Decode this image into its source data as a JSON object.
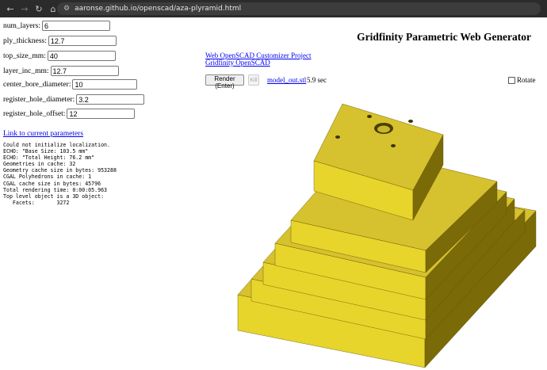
{
  "browser": {
    "url": "aaronse.github.io/openscad/aza-plyramid.html",
    "back_glyph": "←",
    "forward_glyph": "→",
    "reload_glyph": "↻",
    "home_glyph": "⌂",
    "tune_glyph": "⚙"
  },
  "form": {
    "fields": [
      {
        "label": "num_layers:",
        "value": "6"
      },
      {
        "label": "ply_thickness:",
        "value": "12.7"
      },
      {
        "label": "top_size_mm:",
        "value": "40"
      },
      {
        "label": "layer_inc_mm:",
        "value": "12.7"
      },
      {
        "label": "center_bore_diameter:",
        "value": "10"
      },
      {
        "label": "register_hole_diameter:",
        "value": "3.2"
      },
      {
        "label": "register_hole_offset:",
        "value": "12"
      }
    ],
    "params_link": "Link to current parameters"
  },
  "console": [
    "Could not initialize localization.",
    "ECHO: \"Base Size: 103.5 mm\"",
    "ECHO: \"Total Height: 76.2 mm\"",
    "Geometries in cache: 32",
    "Geometry cache size in bytes: 953288",
    "CGAL Polyhedrons in cache: 1",
    "CGAL cache size in bytes: 45796",
    "Total rendering time: 0:00:05.963",
    "Top level object is a 3D object:",
    "   Facets:       3272"
  ],
  "header": {
    "title": "Gridfinity Parametric Web Generator",
    "links": [
      "Web OpenSCAD Customizer Project",
      "Gridfinity OpenSCAD"
    ]
  },
  "toolbar": {
    "render_label": "Render (Enter)",
    "kill_label": "Kill",
    "output_file": "model_out.stl",
    "render_time": "5.9 sec",
    "rotate_label": "Rotate",
    "rotate_checked": false
  },
  "model": {
    "color_top": "#d6c12e",
    "color_front": "#e8d52c",
    "color_side": "#7a6a08"
  }
}
